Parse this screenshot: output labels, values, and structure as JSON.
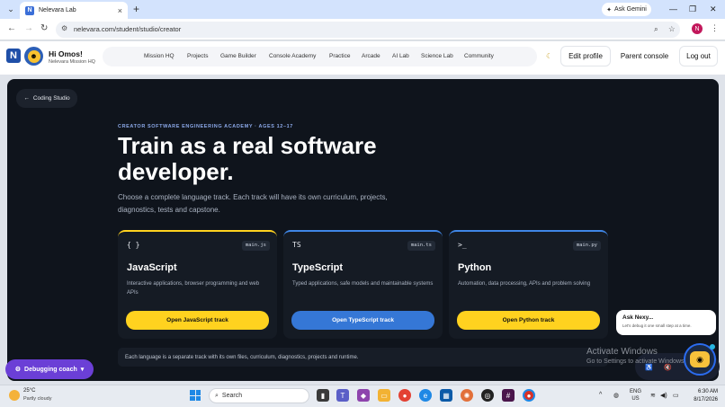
{
  "browser": {
    "tab_title": "Nelevara Lab",
    "tab_favicon": "N",
    "ask_gemini": "Ask Gemini",
    "url": "nelevara.com/student/studio/creator",
    "profile_initial": "N"
  },
  "header": {
    "logo": "N",
    "greeting": "Hi Omos!",
    "subtitle": "Nelevara Mission HQ",
    "nav": [
      "Mission HQ",
      "Projects",
      "Game Builder",
      "Console Academy",
      "Practice",
      "Arcade",
      "AI Lab",
      "Science Lab",
      "Community"
    ],
    "edit_profile": "Edit profile",
    "parent_console": "Parent console",
    "log_out": "Log out"
  },
  "page": {
    "back_label": "Coding Studio",
    "kicker": "CREATOR SOFTWARE ENGINEERING ACADEMY · AGES 12–17",
    "headline": "Train as a real software developer.",
    "lede": "Choose a complete language track. Each track will have its own curriculum, projects, diagnostics, tests and capstone.",
    "tracks": [
      {
        "icon": "{ }",
        "file": "main.js",
        "title": "JavaScript",
        "desc": "Interactive applications, browser programming and web APIs",
        "button": "Open JavaScript track",
        "accent": "#ffd21f",
        "button_color": "#ffd21f",
        "button_text_color": "#111111"
      },
      {
        "icon": "TS",
        "file": "main.ts",
        "title": "TypeScript",
        "desc": "Typed applications, safe models and maintainable systems",
        "button": "Open TypeScript track",
        "accent": "#3f86e6",
        "button_color": "#3577d6",
        "button_text_color": "#ffffff"
      },
      {
        "icon": ">_",
        "file": "main.py",
        "title": "Python",
        "desc": "Automation, data processing, APIs and problem solving",
        "button": "Open Python track",
        "accent": "#3f86e6",
        "button_color": "#ffd21f",
        "button_text_color": "#111111"
      }
    ],
    "note": "Each language is a separate track with its own files, curriculum, diagnostics, projects and runtime."
  },
  "assistant": {
    "debug_coach": "Debugging coach",
    "bubble_title": "Ask Nexy...",
    "bubble_sub": "Let's debug it one small step at a time."
  },
  "watermark": {
    "line1": "Activate Windows",
    "line2": "Go to Settings to activate Windows."
  },
  "taskbar": {
    "temp": "25°C",
    "weather": "Partly cloudy",
    "search": "Search",
    "lang1": "ENG",
    "lang2": "US",
    "time": "6:30 AM",
    "date": "8/17/2026"
  }
}
